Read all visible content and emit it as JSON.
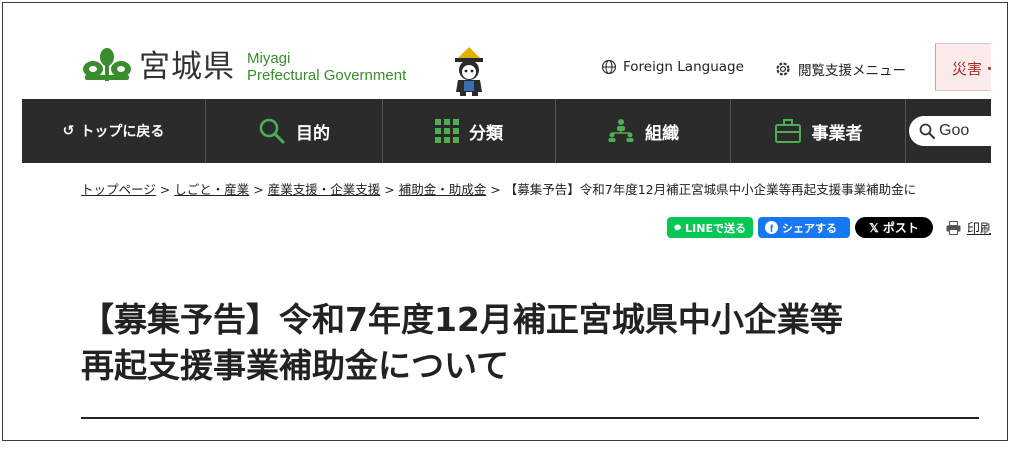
{
  "header": {
    "logo_kanji": "宮城県",
    "logo_en_line1": "Miyagi",
    "logo_en_line2": "Prefectural Government",
    "foreign_language": "Foreign Language",
    "accessibility_menu": "閲覧支援メニュー",
    "disaster": "災害・"
  },
  "nav": {
    "home": "トップに戻る",
    "purpose": "目的",
    "category": "分類",
    "organization": "組織",
    "business": "事業者",
    "search_placeholder": "Goo"
  },
  "breadcrumb": {
    "items": [
      "トップページ",
      "しごと・産業",
      "産業支援・企業支援",
      "補助金・助成金"
    ],
    "separator": ">",
    "current": "【募集予告】令和7年度12月補正宮城県中小企業等再起支援事業補助金に"
  },
  "share": {
    "line": "LINEで送る",
    "facebook": "シェアする",
    "x": "ポスト",
    "print": "印刷"
  },
  "page": {
    "title_line1": "【募集予告】令和7年度12月補正宮城県中小企業等",
    "title_line2": "再起支援事業補助金について"
  },
  "colors": {
    "brand_green": "#3a8c2e",
    "nav_bg": "#2b2b2b",
    "line_green": "#06c755",
    "facebook_blue": "#1877f2",
    "disaster_red": "#b02a26"
  }
}
